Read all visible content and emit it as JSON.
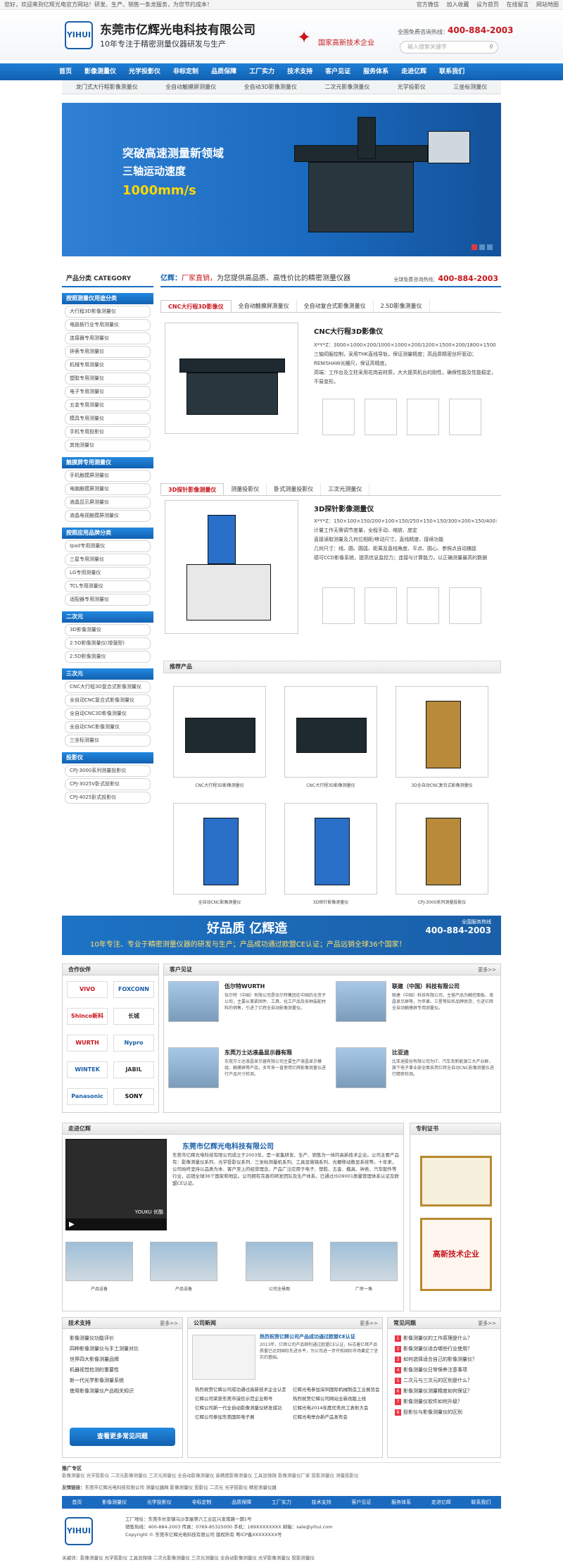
{
  "topbar": {
    "welcome": "您好，欢迎来到亿辉光电官方网站！研发、生产、销售一条龙服务，为您节约成本！",
    "links": [
      "官方微信",
      "加入收藏",
      "设为首页",
      "在线留言",
      "网站地图"
    ]
  },
  "header": {
    "logo_text": "YIHUI",
    "company": "东莞市亿辉光电科技有限公司",
    "slogan": "10年专注于精密测量仪器研发与生产",
    "hnt_text": "国家高新技术企业",
    "hotline_label": "全国免费咨询热线：",
    "hotline": "400-884-2003",
    "search_placeholder": "输入搜索关键字"
  },
  "nav": [
    "首页",
    "影像测量仪",
    "光学投影仪",
    "非标定制",
    "品质保障",
    "工厂实力",
    "技术支持",
    "客户见证",
    "服务体系",
    "走进亿辉",
    "联系我们"
  ],
  "subnav": [
    "龙门式大行程影像测量仪",
    "全自动触摸屏测量仪",
    "全自动3D影像测量仪",
    "二次元影像测量仪",
    "光学投影仪",
    "三坐标测量仪"
  ],
  "banner": {
    "line1": "突破高速测量新领域",
    "line2": "三轴运动速度",
    "line3": "1000mm/s",
    "dots": [
      "1",
      "2",
      "3"
    ]
  },
  "sidebar": {
    "title": "产品分类 CATEGORY",
    "cats": [
      {
        "head": "按照测量仪用途分类",
        "items": [
          "大行程3D影像测量仪",
          "电路板行业专用测量仪",
          "连接器专用测量仪",
          "钟表专用测量仪",
          "机械专用测量仪",
          "塑胶专用测量仪",
          "电子专用测量仪",
          "五金专用测量仪",
          "模具专用测量仪",
          "手机专用投影仪",
          "其他测量仪"
        ]
      },
      {
        "head": "触摸屏专用测量仪",
        "items": [
          "手机触摸屏测量仪",
          "电脑触摸屏测量仪",
          "液晶显示屏测量仪",
          "液晶电视触摸屏测量仪"
        ]
      },
      {
        "head": "按照应用品牌分类",
        "items": [
          "Ipad专用测量仪",
          "三星专用测量仪",
          "LG专用测量仪",
          "TCL专用测量仪",
          "适配器专用测量仪"
        ]
      },
      {
        "head": "二次元",
        "items": [
          "3D影像测量仪",
          "2.5D影像测量仪(增强型)",
          "2.5D影像测量仪"
        ]
      },
      {
        "head": "三次元",
        "items": [
          "CNC大行程3D复合式影像测量仪",
          "全自动CNC复合式影像测量仪",
          "全自动CNC3D影像测量仪",
          "全自动CNC影像测量仪",
          "三坐标测量仪"
        ]
      },
      {
        "head": "投影仪",
        "items": [
          "CPJ-3000系列测量投影仪",
          "CPJ-3025V卧式投影仪",
          "CPJ-4025卧式投影仪"
        ]
      }
    ]
  },
  "mainhead": {
    "brand": "亿辉：",
    "hl": "厂家直销，",
    "rest": "为您提供高品质、高性价比的精密测量仪器",
    "hot_label": "全球免费咨询热线：",
    "hot": "400-884-2003"
  },
  "product1": {
    "tabs": [
      "CNC大行程3D影像仪",
      "全自动触摸屏测量仪",
      "全自动复合式影像测量仪",
      "2.5D影像测量仪"
    ],
    "title": "CNC大行程3D影像仪",
    "bullets": [
      "X*Y*Z：3000×1000×200/1000×1000×200/1200×1500×200/1800×1500×200",
      "三轴伺服控制，采用THK直线导轨，保证测量精度；高品质精密丝杆驱动；",
      "RENISHAW光栅尺，保证高精度。",
      "高端：工作台及立柱采用花岗岩材质，大大提高机台的刚性，确保性能及性能稳定，不易变形。"
    ]
  },
  "product2": {
    "tabs": [
      "3D探针影像测量仪",
      "测量投影仪",
      "卧式测量投影仪",
      "三次元测量仪"
    ],
    "title": "3D探针影像测量仪",
    "bullets": [
      "X*Y*Z：150×100×150/200×100×150/250×150×150/300×200×150/400×300×150",
      "计量工作无需调节度量，全程手动、缩放、度定",
      "直接读取测量及几何位相距/移动尺寸，直线精度、接续功能",
      "几何尺寸：线、圆、圆弧、距离及直线角度、平点、圆心、参照点自动捕捉",
      "德可CCD影像系统，提高信息监控力；连接与计算能力，以正确测量最高的数据"
    ]
  },
  "recommend": {
    "title": "推荐产品",
    "items": [
      "CNC大行程3D影像测量仪",
      "CNC大行程3D影像测量仪",
      "3D全自动CNC复合式影像测量仪",
      "全自动CNC影像测量仪",
      "3D探针影像测量仪",
      "CPJ-3000系列测量投影仪"
    ]
  },
  "bigbanner": {
    "t1": "好品质  亿辉造",
    "t2": "10年专注、专业于精密测量仪器的研发与生产；产品成功通过欧盟CE认证；产品远销全球36个国家！",
    "hot_label": "全国服务热线",
    "hot": "400-884-2003"
  },
  "partners": {
    "title": "合作伙伴",
    "logos": [
      "VIVO",
      "FOXCONN",
      "Shinco新科",
      "长城",
      "WURTH",
      "Nypro",
      "WINTEK",
      "JABIL",
      "Panasonic",
      "SONY"
    ]
  },
  "clients": {
    "title": "客户见证",
    "more": "更多>>",
    "items": [
      {
        "name": "伍尔特WURTH",
        "desc": "伍尔特（中国）有限公司是伍尔特集团在中国的全资子公司，主要从事紧固件、工具、化工产品及各种装配材料的销售，引进了亿辉全自动影像测量仪。"
      },
      {
        "name": "联建（中国）科技有限公司",
        "desc": "联建（中国）科技有限公司，主营产品为触控面板、液晶显示屏等，为苹果、三星等知名品牌供货，引进亿辉全自动触摸屏专用测量仪。"
      },
      {
        "name": "东莞万士达液晶显示器有限",
        "desc": "东莞万士达液晶显示器有限公司主要生产液晶显示模组、触摸屏等产品，多年来一直使用亿辉影像测量仪进行产品尺寸检测。"
      },
      {
        "name": "比亚迪",
        "desc": "比亚迪股份有限公司为IT、汽车及新能源三大产业群，旗下电子事业部全面采用亿辉全自动CNC影像测量仪进行精密检测。"
      }
    ]
  },
  "about": {
    "title": "走进亿辉",
    "company": "东莞市亿辉光电科技有限公司",
    "text": "东莞市亿辉光电科技有限公司成立于2003年，是一家集研发、生产、销售为一体的高新技术企业。公司主要产品有：影像测量仪系列、光学投影仪系列、三坐标测量机系列、工具显微镜系列、光栅移动数显系统等。十年来，公司始终坚持以品质为本、客户至上的经营理念，产品广泛应用于电子、塑胶、五金、模具、钟表、汽车配件等行业，远销全球36个国家和地区。公司拥有完善的研发团队及生产体系，已通过ISO9001质量管理体系认证及欧盟CE认证。",
    "video_brand": "YOUKU 优酷",
    "photos": [
      "产品设备",
      "产品设备",
      "公司全景图",
      "厂房一角"
    ]
  },
  "honors": {
    "title": "专利证书",
    "cert": "高新技术企业"
  },
  "tech": {
    "title": "技术支持",
    "more": "更多>>",
    "items": [
      "影像测量仪功能评价",
      "四种影像测量仪与手工测量对比",
      "世界四大影像测量品牌",
      "机器视觉检测的重要性",
      "新一代光学影像测量系统",
      "使用影像测量仪产品相关知识"
    ],
    "button": "查看更多常见问题"
  },
  "news": {
    "title": "公司新闻",
    "more": "更多>>",
    "headline": "热烈祝贺亿辉公司产品成功通过欧盟CE认证",
    "summary": "2013年，亿辉公司产品顺利通过欧盟CE认证，标志着亿辉产品质量已达到国际先进水平，为公司进一步开拓国际市场奠定了坚实的基础。",
    "items": [
      "热烈祝贺亿辉公司成功通过高新技术企业认定",
      "亿辉光电参加深圳国际机械制造工业展览会",
      "亿辉公司荣获东莞市诚信示范企业称号",
      "热烈祝贺亿辉公司网站全新改版上线",
      "亿辉公司新一代全自动影像测量仪研发成功",
      "亿辉光电2014年度优秀员工表彰大会",
      "亿辉公司参加东莞国际电子展",
      "亿辉光电举办新产品发布会"
    ]
  },
  "faq": {
    "title": "常见问题",
    "more": "更多>>",
    "items": [
      "影像测量仪的工作原理是什么？",
      "影像测量仪适合哪些行业使用？",
      "如何选择适合自己的影像测量仪？",
      "影像测量仪日常保养注意事项",
      "二次元与三次元的区别是什么？",
      "影像测量仪测量精度如何保证？",
      "影像测量仪软件如何升级？",
      "投影仪与影像测量仪的区别"
    ]
  },
  "promo": {
    "label": "推广专区",
    "text": "影像测量仪 光学投影仪 二次元影像测量仪 三次元测量仪 全自动影像测量仪 高精度影像测量仪 工具显微镜 影像测量仪厂家 投影测量仪 测量投影仪"
  },
  "friends": {
    "label": "友情链接：",
    "text": "东莞市亿辉光电科技有限公司 测量仪器网 影像测量仪 投影仪 二次元 光学投影仪 精密测量仪器"
  },
  "footnav": [
    "首页",
    "影像测量仪",
    "光学投影仪",
    "非标定制",
    "品质保障",
    "工厂实力",
    "技术支持",
    "客户见证",
    "服务体系",
    "走进亿辉",
    "联系我们"
  ],
  "footer": {
    "logo_text": "YIHUI",
    "line1": "工厂地址：东莞市长安镇乌沙李屋第六工业区兴发南路一期1号",
    "line2": "销售热线：400-884-2003  传真：0769-85325000  手机：189XXXXXXXX  邮箱：sale@yihui.com",
    "line3": "Copyright © 东莞市亿辉光电科技有限公司 版权所有  粤ICP备XXXXXXXX号",
    "keywords": "关键词：影像测量仪 光学投影仪 工具显微镜 二次元影像测量仪 三次元测量仪 全自动影像测量仪 光学影像测量仪 投影测量仪"
  }
}
